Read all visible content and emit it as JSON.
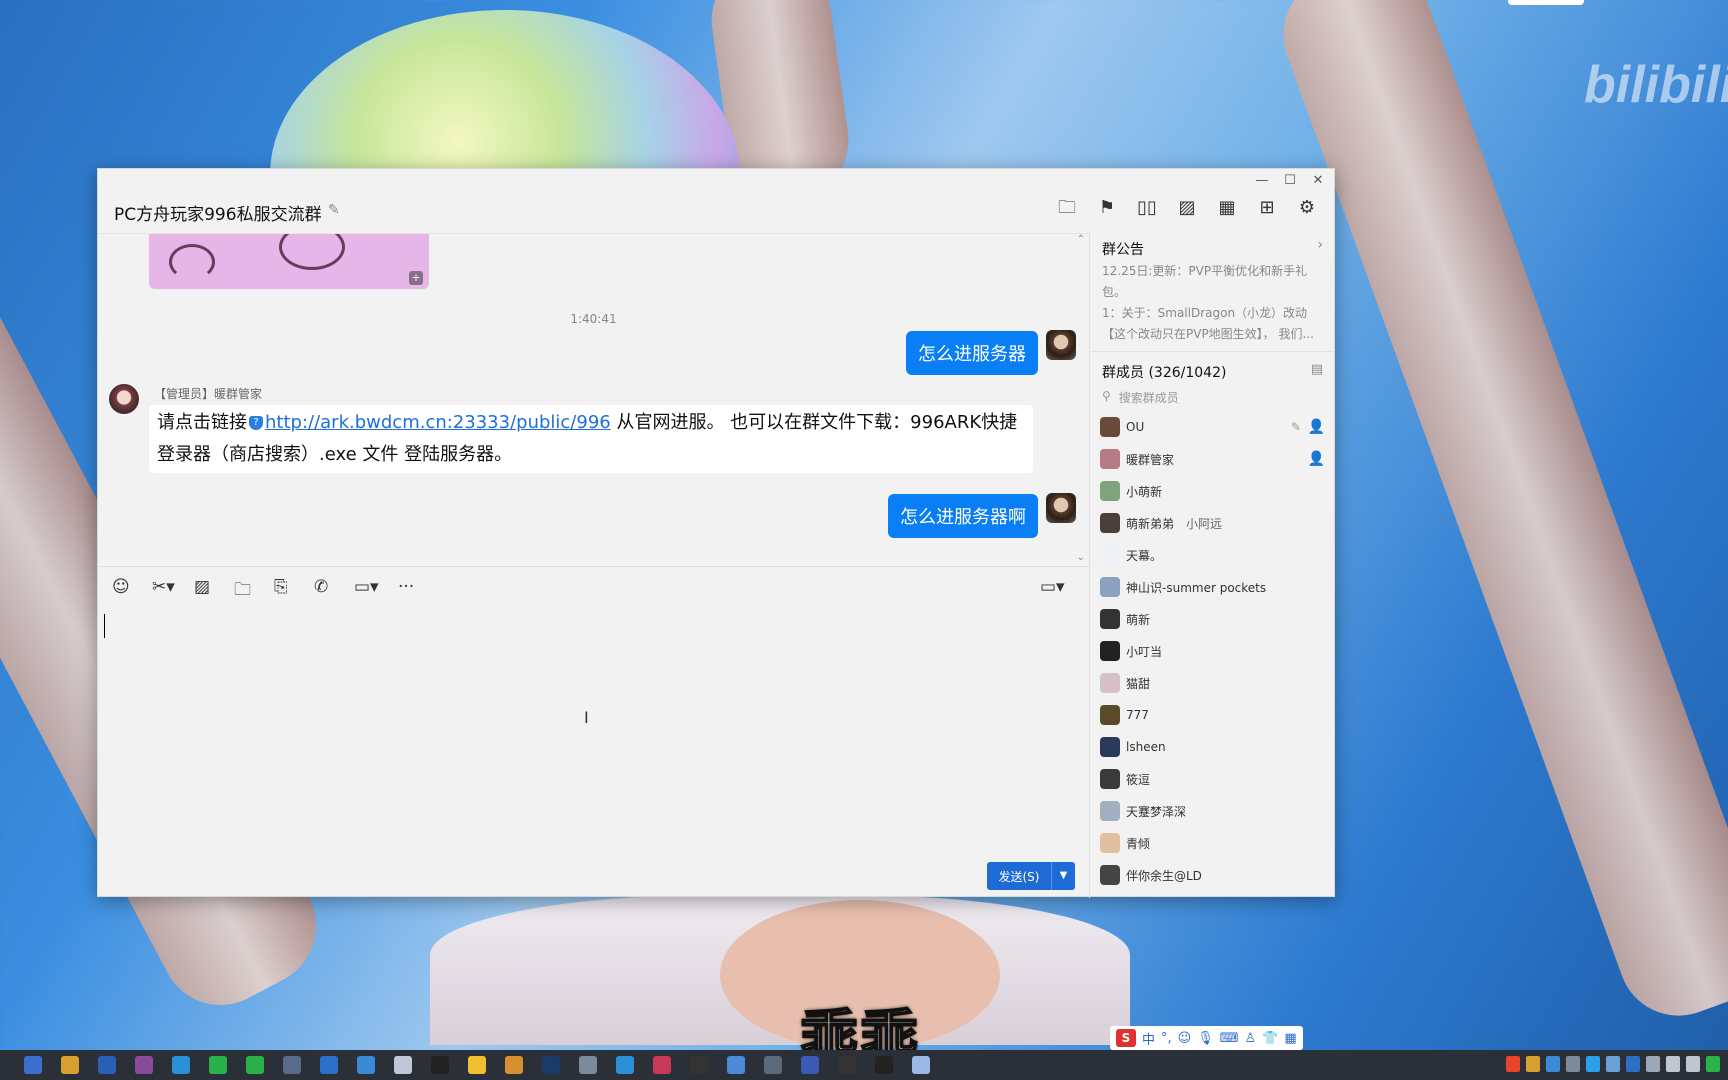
{
  "wallpaper": {
    "watermark": "bilibili",
    "subtitle": "乖乖"
  },
  "window": {
    "title": "PC方舟玩家996私服交流群",
    "controls": {
      "minimize": "—",
      "maximize": "☐",
      "close": "✕"
    },
    "tools": [
      "folder-icon",
      "flag-icon",
      "book-icon",
      "image-icon",
      "apps-icon",
      "add-icon",
      "settings-icon"
    ]
  },
  "chat": {
    "timestamp": "1:40:41",
    "messages": [
      {
        "from": "me",
        "text": "怎么进服务器"
      },
      {
        "from": "admin",
        "sender": "【管理员】暖群管家",
        "pre": "请点击链接",
        "link": "http://ark.bwdcm.cn:23333/public/996",
        "post": " 从官网进服。 也可以在群文件下载：996ARK快捷登录器（商店搜索）.exe 文件 登陆服务器。"
      },
      {
        "from": "me",
        "text": "怎么进服务器啊"
      }
    ]
  },
  "input": {
    "send_label": "发送(S)",
    "toolbar": [
      "emoji-icon",
      "scissors-icon",
      "image-icon",
      "folder-icon",
      "redpacket-icon",
      "phone-icon",
      "video-icon",
      "more-icon"
    ]
  },
  "sidebar": {
    "notice_title": "群公告",
    "notice_text": "12.25日:更新：PVP平衡优化和新手礼包。\n1：关于：SmallDragon（小龙）改动【这个改动只在PVP地图生效】，   我们...",
    "members_title": "群成员 (326/1042)",
    "search_placeholder": "搜索群成员",
    "members": [
      {
        "name": "OU",
        "sub": "",
        "color": "#6b4a3a"
      },
      {
        "name": "暖群管家",
        "sub": "",
        "color": "#b57a86"
      },
      {
        "name": "小萌新",
        "sub": "",
        "color": "#7fa37a"
      },
      {
        "name": "萌新弟弟",
        "sub": "小阿远",
        "color": "#4a3f3a"
      },
      {
        "name": "天幕。",
        "sub": "",
        "color": "#eef2f6"
      },
      {
        "name": "神山识-summer pockets",
        "sub": "",
        "color": "#8aa2c0"
      },
      {
        "name": "萌新",
        "sub": "",
        "color": "#333333"
      },
      {
        "name": "小叮当",
        "sub": "",
        "color": "#222222"
      },
      {
        "name": "猫甜",
        "sub": "",
        "color": "#d8c0c8"
      },
      {
        "name": "777",
        "sub": "",
        "color": "#5a4a2a"
      },
      {
        "name": "lsheen",
        "sub": "",
        "color": "#2a3a5a"
      },
      {
        "name": "筱逗",
        "sub": "",
        "color": "#3a3a3a"
      },
      {
        "name": "天蹇梦泽深",
        "sub": "",
        "color": "#a0b0c0"
      },
      {
        "name": "青倾",
        "sub": "",
        "color": "#e0c0a0"
      },
      {
        "name": "伴你余生@LD",
        "sub": "",
        "color": "#444444"
      }
    ]
  },
  "ime": {
    "logo": "S",
    "lang": "中"
  }
}
